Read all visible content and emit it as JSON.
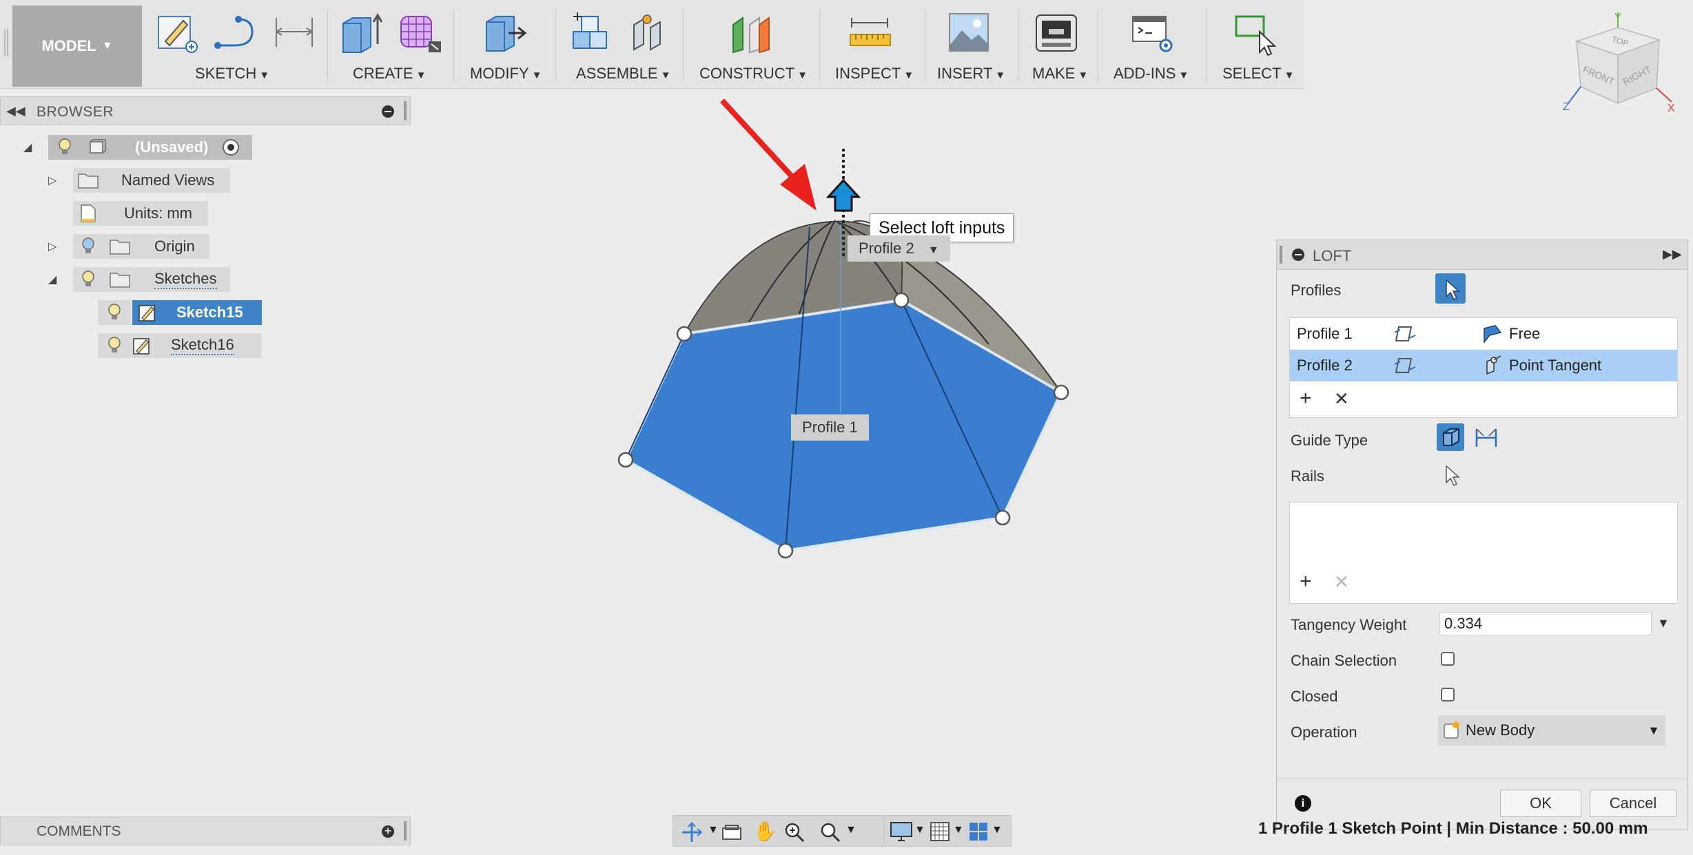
{
  "toolbar": {
    "model_label": "MODEL",
    "groups": [
      {
        "label": "SKETCH"
      },
      {
        "label": "CREATE"
      },
      {
        "label": "MODIFY"
      },
      {
        "label": "ASSEMBLE"
      },
      {
        "label": "CONSTRUCT"
      },
      {
        "label": "INSPECT"
      },
      {
        "label": "INSERT"
      },
      {
        "label": "MAKE"
      },
      {
        "label": "ADD-INS"
      },
      {
        "label": "SELECT"
      }
    ]
  },
  "viewcube": {
    "top": "TOP",
    "front": "FRONT",
    "right": "RIGHT",
    "axis_x": "X",
    "axis_y": "Y",
    "axis_z": "Z"
  },
  "browser": {
    "title": "BROWSER",
    "root": "(Unsaved)",
    "named_views": "Named Views",
    "units": "Units: mm",
    "origin": "Origin",
    "sketches": "Sketches",
    "sketch15": "Sketch15",
    "sketch16": "Sketch16"
  },
  "viewport": {
    "tooltip": "Select loft inputs",
    "profile2_label": "Profile 2",
    "profile1_label": "Profile 1",
    "colors": {
      "profile_face": "#3a7fcf",
      "loft_surface": "#8c8a82",
      "annotation_arrow": "#e8231d",
      "manipulator": "#1a8fd8"
    }
  },
  "loft": {
    "title": "LOFT",
    "profiles_label": "Profiles",
    "profile_rows": [
      {
        "name": "Profile 1",
        "condition": "Free"
      },
      {
        "name": "Profile 2",
        "condition": "Point Tangent"
      }
    ],
    "guide_type_label": "Guide Type",
    "rails_label": "Rails",
    "tangency_weight_label": "Tangency Weight",
    "tangency_weight_value": "0.334",
    "chain_selection_label": "Chain Selection",
    "closed_label": "Closed",
    "operation_label": "Operation",
    "operation_value": "New Body",
    "ok_label": "OK",
    "cancel_label": "Cancel"
  },
  "comments": {
    "title": "COMMENTS"
  },
  "status": {
    "text": "1 Profile 1 Sketch Point | Min Distance : 50.00 mm"
  }
}
